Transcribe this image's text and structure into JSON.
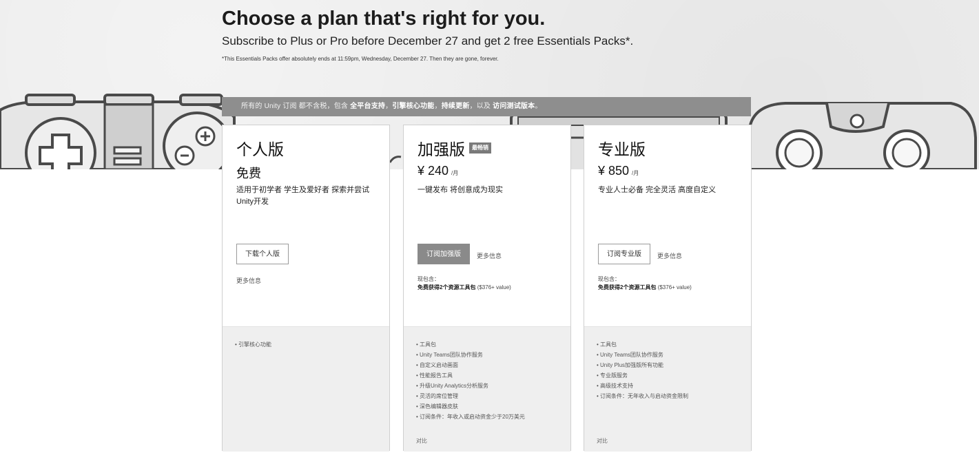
{
  "hero": {
    "title": "Choose a plan that's right for you.",
    "subtitle": "Subscribe to Plus or Pro before December 27 and get 2 free Essentials Packs*.",
    "disclaimer": "*This Essentials Packs offer absolutely ends at 11:59pm, Wednesday, December 27. Then they are gone, forever."
  },
  "info_bar": {
    "prefix": "所有的 Unity 订阅 都不含税，包含",
    "feature1": "全平台支持",
    "sep1": "，",
    "feature2": "引擎核心功能",
    "sep2": "，",
    "feature3": "持续更新",
    "sep3": "，以及",
    "feature4": "访问测试版本",
    "suffix": "。"
  },
  "plans": [
    {
      "name": "个人版",
      "price": "免费",
      "description": "适用于初学者 学生及爱好者 探索并尝试Unity开发",
      "button": "下载个人版",
      "more": "更多信息",
      "features": [
        "• 引擎核心功能"
      ]
    },
    {
      "name": "加强版",
      "badge": "最畅销",
      "price": "¥ 240",
      "period": "/月",
      "description": "一键发布 将创意成为现实",
      "button": "订阅加强版",
      "more": "更多信息",
      "includes_label": "现包含：",
      "includes_bold": "免费获得2个资源工具包",
      "includes_value": "($376+ value)",
      "features": [
        "• 工具包",
        "• Unity Teams团队协作服务",
        "• 自定义启动画面",
        "• 性能报告工具",
        "• 升级Unity Analytics分析服务",
        "• 灵活的席位管理",
        "• 深色编辑器皮肤",
        "• 订阅条件：年收入或启动资金少于20万美元"
      ],
      "compare": "对比"
    },
    {
      "name": "专业版",
      "price": "¥ 850",
      "period": "/月",
      "description": "专业人士必备 完全灵活 高度自定义",
      "button": "订阅专业版",
      "more": "更多信息",
      "includes_label": "现包含：",
      "includes_bold": "免费获得2个资源工具包",
      "includes_value": "($376+ value)",
      "features": [
        "• 工具包",
        "• Unity Teams团队协作服务",
        "• Unity Plus加强版所有功能",
        "• 专业版服务",
        "• 高级技术支持",
        "• 订阅条件：无年收入与启动资金限制"
      ],
      "compare": "对比"
    }
  ],
  "colors": {
    "hero_bg": "#ededed",
    "bar_bg": "#8e8e8e",
    "button_solid": "#8a8a8a",
    "card_bottom": "#efefef"
  }
}
